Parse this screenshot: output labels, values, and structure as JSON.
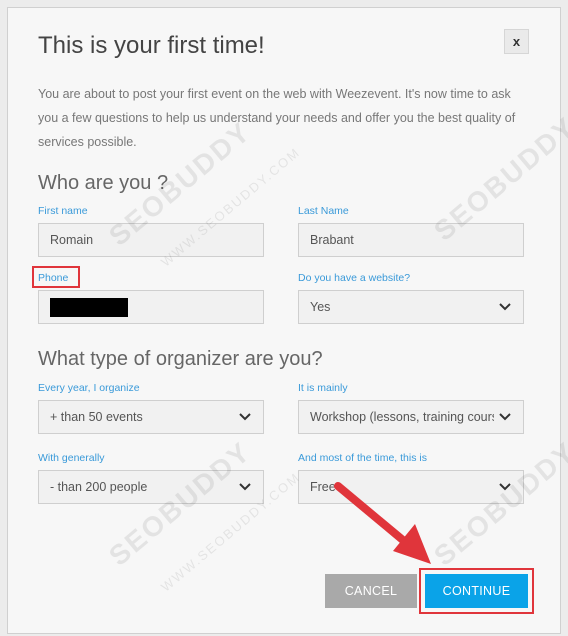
{
  "modal": {
    "title": "This is your first time!",
    "close_label": "x",
    "intro": "You are about to post your first event on the web with Weezevent. It's now time to ask you a few questions to help us understand your needs and offer you the best quality of services possible."
  },
  "who_section": {
    "title": "Who are you ?",
    "first_name": {
      "label": "First name",
      "value": "Romain"
    },
    "last_name": {
      "label": "Last Name",
      "value": "Brabant"
    },
    "phone": {
      "label": "Phone",
      "value": ""
    },
    "website": {
      "label": "Do you have a website?",
      "selected": "Yes"
    }
  },
  "organizer_section": {
    "title": "What type of organizer are you?",
    "every_year": {
      "label": "Every year, I organize",
      "selected": "+ than 50 events"
    },
    "it_is_mainly": {
      "label": "It is mainly",
      "selected": "Workshop (lessons, training cours"
    },
    "with_generally": {
      "label": "With generally",
      "selected": "- than 200 people"
    },
    "most_of_time": {
      "label": "And most of the time, this is",
      "selected": "Free"
    }
  },
  "actions": {
    "cancel_label": "CANCEL",
    "continue_label": "CONTINUE"
  },
  "watermark": {
    "brand": "SEOBUDDY",
    "url": "WWW.SEOBUDDY.COM"
  },
  "colors": {
    "label_blue": "#3a9ad9",
    "continue_blue": "#0aa3e8",
    "cancel_gray": "#a9a9a9",
    "highlight_red": "#e0353b"
  },
  "icons": {
    "close": "close-icon",
    "select": "chevron-down-icon",
    "annotation": "red-arrow"
  }
}
